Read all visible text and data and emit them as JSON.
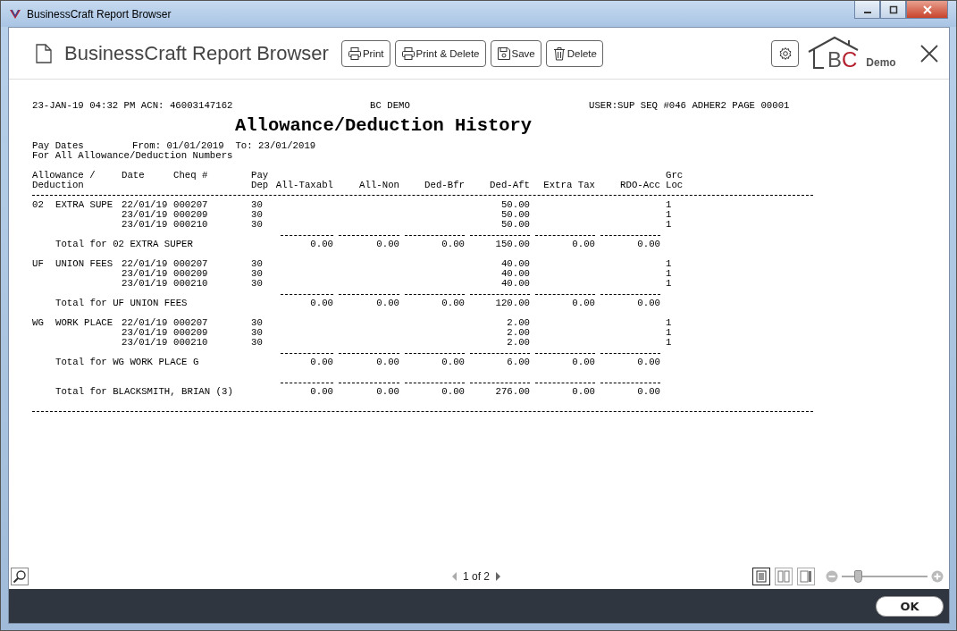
{
  "window": {
    "title": "BusinessCraft Report Browser"
  },
  "toolbar": {
    "title": "BusinessCraft Report Browser",
    "buttons": [
      {
        "label": "Print",
        "kind": "print"
      },
      {
        "label": "Print & Delete",
        "kind": "print"
      },
      {
        "label": "Save",
        "kind": "save"
      },
      {
        "label": "Delete",
        "kind": "delete"
      }
    ],
    "logo": {
      "letters": [
        "B",
        "C"
      ],
      "caption": "Demo"
    }
  },
  "report": {
    "header_left": "23-JAN-19 04:32 PM ACN: 46003147162",
    "header_center": "BC DEMO",
    "header_right": "USER:SUP SEQ #046 ADHER2 PAGE 00001",
    "title": "Allowance/Deduction History",
    "pay_dates_label": "Pay Dates",
    "pay_dates_range": "From: 01/01/2019  To: 23/01/2019",
    "scope": "For All Allowance/Deduction Numbers",
    "columns": [
      {
        "top": "Allowance /",
        "bottom": "Deduction"
      },
      {
        "top": "Date"
      },
      {
        "top": "Cheq #"
      },
      {
        "top": "Pay",
        "bottom": "Dep"
      },
      {
        "bottom": "All-Taxabl"
      },
      {
        "bottom": "All-Non"
      },
      {
        "bottom": "Ded-Bfr"
      },
      {
        "bottom": "Ded-Aft"
      },
      {
        "bottom": "Extra Tax"
      },
      {
        "bottom": "RDO-Acc"
      },
      {
        "top": "Grc",
        "bottom": "Loc"
      }
    ],
    "groups": [
      {
        "code": "02",
        "name": "EXTRA SUPE",
        "entries": [
          {
            "date": "22/01/19",
            "cheq": "000207",
            "pay": "30",
            "ded_aft": "50.00",
            "loc": "1"
          },
          {
            "date": "23/01/19",
            "cheq": "000209",
            "pay": "30",
            "ded_aft": "50.00",
            "loc": "1"
          },
          {
            "date": "23/01/19",
            "cheq": "000210",
            "pay": "30",
            "ded_aft": "50.00",
            "loc": "1"
          }
        ],
        "total": {
          "label": "Total for 02 EXTRA SUPER",
          "amounts": [
            "0.00",
            "0.00",
            "0.00",
            "150.00",
            "0.00",
            "0.00"
          ]
        }
      },
      {
        "code": "UF",
        "name": "UNION FEES",
        "entries": [
          {
            "date": "22/01/19",
            "cheq": "000207",
            "pay": "30",
            "ded_aft": "40.00",
            "loc": "1"
          },
          {
            "date": "23/01/19",
            "cheq": "000209",
            "pay": "30",
            "ded_aft": "40.00",
            "loc": "1"
          },
          {
            "date": "23/01/19",
            "cheq": "000210",
            "pay": "30",
            "ded_aft": "40.00",
            "loc": "1"
          }
        ],
        "total": {
          "label": "Total for UF UNION FEES",
          "amounts": [
            "0.00",
            "0.00",
            "0.00",
            "120.00",
            "0.00",
            "0.00"
          ]
        }
      },
      {
        "code": "WG",
        "name": "WORK PLACE",
        "entries": [
          {
            "date": "22/01/19",
            "cheq": "000207",
            "pay": "30",
            "ded_aft": "2.00",
            "loc": "1"
          },
          {
            "date": "23/01/19",
            "cheq": "000209",
            "pay": "30",
            "ded_aft": "2.00",
            "loc": "1"
          },
          {
            "date": "23/01/19",
            "cheq": "000210",
            "pay": "30",
            "ded_aft": "2.00",
            "loc": "1"
          }
        ],
        "total": {
          "label": "Total for WG WORK PLACE G",
          "amounts": [
            "0.00",
            "0.00",
            "0.00",
            "6.00",
            "0.00",
            "0.00"
          ]
        }
      }
    ],
    "grand_total": {
      "label": "Total for BLACKSMITH, BRIAN (3)",
      "amounts": [
        "0.00",
        "0.00",
        "0.00",
        "276.00",
        "0.00",
        "0.00"
      ]
    }
  },
  "status": {
    "pager": "1 of 2",
    "view_modes": [
      {
        "kind": "single",
        "selected": true
      },
      {
        "kind": "double",
        "selected": false
      },
      {
        "kind": "side",
        "selected": false
      }
    ],
    "zoom": {
      "level": 0.2
    }
  },
  "footer": {
    "ok": "OK"
  }
}
